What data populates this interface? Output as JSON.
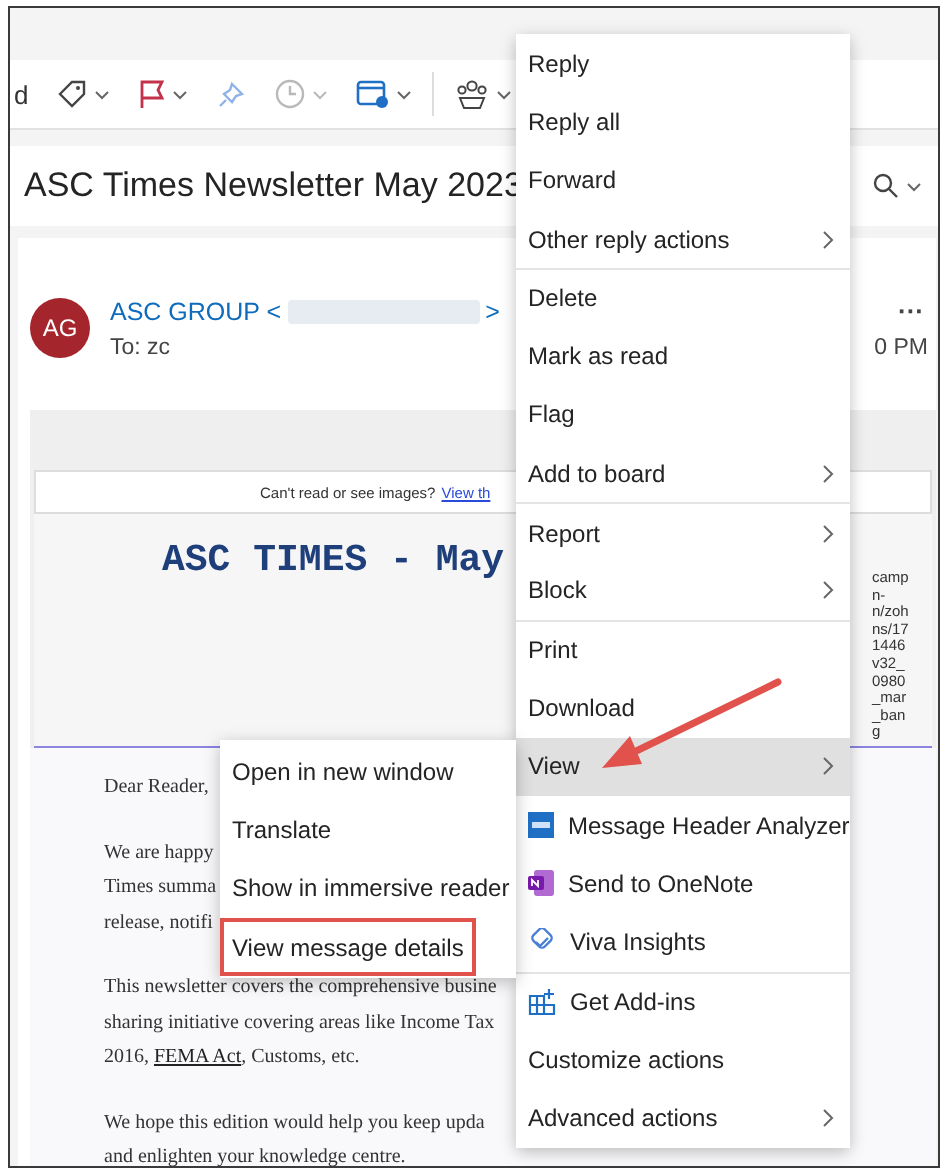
{
  "toolbar": {
    "cut_label": "d",
    "buttons": [
      {
        "kind": "tag",
        "disabled": false,
        "has_dropdown": true
      },
      {
        "kind": "flag",
        "disabled": false,
        "has_dropdown": true
      },
      {
        "kind": "pin",
        "disabled": false,
        "has_dropdown": false
      },
      {
        "kind": "clock",
        "disabled": true,
        "has_dropdown": true
      },
      {
        "kind": "calendar",
        "disabled": false,
        "has_dropdown": true
      },
      {
        "kind": "people",
        "disabled": false,
        "has_dropdown": true
      }
    ]
  },
  "subject": "ASC Times Newsletter May 2023",
  "message": {
    "avatar": "AG",
    "sender": "ASC GROUP <",
    "sender_end": ">",
    "to": "To:  zc",
    "more": "···",
    "time": "0 PM"
  },
  "banner": {
    "notice": "Can't read or see images?",
    "notice_link": "View th",
    "title": "ASC TIMES - May",
    "side_text": [
      "camp",
      "n-",
      "n/zoh",
      "ns/17",
      "1446",
      "v32_",
      "0980",
      "_mar",
      "_ban",
      "g"
    ]
  },
  "body": [
    [
      {
        "parts": [
          {
            "text": "Dear Reader,",
            "kind": "text"
          }
        ]
      }
    ],
    [
      {
        "parts": [
          {
            "text": "We are happy",
            "kind": "text"
          }
        ]
      },
      {
        "parts": [
          {
            "text": "Times summa",
            "kind": "text"
          }
        ]
      },
      {
        "parts": [
          {
            "text": "release, notifi",
            "kind": "text"
          }
        ]
      }
    ],
    [
      {
        "parts": [
          {
            "text": "This newsletter covers the comprehensive busine",
            "kind": "text"
          }
        ]
      },
      {
        "parts": [
          {
            "text": "sharing initiative covering areas like Income Tax",
            "kind": "text"
          }
        ]
      },
      {
        "parts": [
          {
            "text": "2016, ",
            "kind": "text"
          },
          {
            "text": "FEMA Act",
            "kind": "link"
          },
          {
            "text": ", Customs, etc.",
            "kind": "text"
          }
        ]
      }
    ],
    [
      {
        "parts": [
          {
            "text": "We hope this edition would help you keep upda",
            "kind": "text"
          }
        ]
      },
      {
        "parts": [
          {
            "text": "and enlighten your knowledge centre.",
            "kind": "text"
          }
        ]
      }
    ]
  ],
  "menu": {
    "items": [
      {
        "label": "Reply",
        "kind": "text",
        "selected": false,
        "divider_before": false
      },
      {
        "label": "Reply all",
        "kind": "text",
        "selected": false,
        "divider_before": false
      },
      {
        "label": "Forward",
        "kind": "text",
        "selected": false,
        "divider_before": false
      },
      {
        "label": "Other reply actions",
        "kind": "submenu",
        "selected": false,
        "divider_before": false
      },
      {
        "label": "Delete",
        "kind": "text",
        "selected": false,
        "divider_before": true
      },
      {
        "label": "Mark as read",
        "kind": "text",
        "selected": false,
        "divider_before": false
      },
      {
        "label": "Flag",
        "kind": "text",
        "selected": false,
        "divider_before": false
      },
      {
        "label": "Add to board",
        "kind": "submenu",
        "selected": false,
        "divider_before": false
      },
      {
        "label": "Report",
        "kind": "submenu",
        "selected": false,
        "divider_before": true
      },
      {
        "label": "Block",
        "kind": "submenu",
        "selected": false,
        "divider_before": false
      },
      {
        "label": "Print",
        "kind": "text",
        "selected": false,
        "divider_before": true
      },
      {
        "label": "Download",
        "kind": "text",
        "selected": false,
        "divider_before": false
      },
      {
        "label": "View",
        "kind": "submenu",
        "selected": true,
        "divider_before": false
      },
      {
        "label": "Message Header Analyzer",
        "kind": "mha",
        "selected": false,
        "divider_before": false
      },
      {
        "label": "Send to OneNote",
        "kind": "onenote",
        "selected": false,
        "divider_before": false
      },
      {
        "label": "Viva Insights",
        "kind": "viva",
        "selected": false,
        "divider_before": false
      },
      {
        "label": "Get Add-ins",
        "kind": "addins",
        "selected": false,
        "divider_before": true
      },
      {
        "label": "Customize actions",
        "kind": "text",
        "selected": false,
        "divider_before": false
      },
      {
        "label": "Advanced actions",
        "kind": "submenu",
        "selected": false,
        "divider_before": false
      }
    ]
  },
  "submenu": {
    "items": [
      {
        "label": "Open in new window",
        "outlined": false
      },
      {
        "label": "Translate",
        "outlined": false
      },
      {
        "label": "Show in immersive reader",
        "outlined": false
      },
      {
        "label": "View message details",
        "outlined": true
      }
    ]
  }
}
